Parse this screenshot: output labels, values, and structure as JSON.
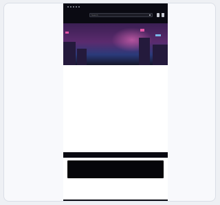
{
  "header": {
    "search_placeholder": "Search"
  },
  "hero": {
    "title": "",
    "subtitle": ""
  },
  "categories": [],
  "filters": [],
  "sections": [],
  "features": [],
  "promo": {
    "line1": "",
    "line2": ""
  },
  "info": {
    "line1": "",
    "line2": ""
  },
  "footer": {
    "text": ""
  },
  "colors": {
    "accent": "#a45de8",
    "topbar": "#0a0a12",
    "hero_pink": "#ff5fb3"
  }
}
